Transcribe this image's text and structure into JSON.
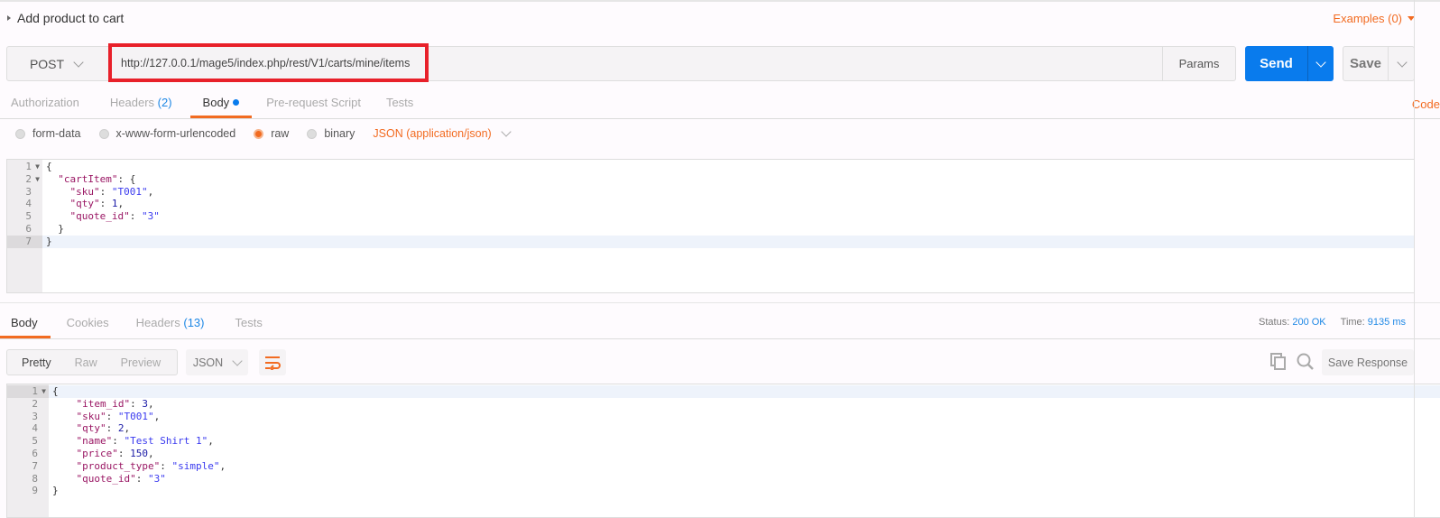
{
  "request": {
    "title": "Add product to cart",
    "examples_label": "Examples (0)",
    "method": "POST",
    "url": "http://127.0.0.1/mage5/index.php/rest/V1/carts/mine/items",
    "params_label": "Params",
    "send_label": "Send",
    "save_label": "Save",
    "code_label": "Code",
    "tabs": [
      {
        "label": "Authorization",
        "count": ""
      },
      {
        "label": "Headers",
        "count": "(2)"
      },
      {
        "label": "Body",
        "count": ""
      },
      {
        "label": "Pre-request Script",
        "count": ""
      },
      {
        "label": "Tests",
        "count": ""
      }
    ],
    "active_tab": "Body",
    "body_modes": [
      "form-data",
      "x-www-form-urlencoded",
      "raw",
      "binary"
    ],
    "selected_mode": "raw",
    "content_type": "JSON (application/json)",
    "body_lines": [
      [
        [
          "p",
          "{"
        ]
      ],
      [
        [
          "p",
          "  "
        ],
        [
          "k",
          "\"cartItem\""
        ],
        [
          "p",
          ": {"
        ]
      ],
      [
        [
          "p",
          "    "
        ],
        [
          "k",
          "\"sku\""
        ],
        [
          "p",
          ": "
        ],
        [
          "s",
          "\"T001\""
        ],
        [
          "p",
          ","
        ]
      ],
      [
        [
          "p",
          "    "
        ],
        [
          "k",
          "\"qty\""
        ],
        [
          "p",
          ": "
        ],
        [
          "n",
          "1"
        ],
        [
          "p",
          ","
        ]
      ],
      [
        [
          "p",
          "    "
        ],
        [
          "k",
          "\"quote_id\""
        ],
        [
          "p",
          ": "
        ],
        [
          "s",
          "\"3\""
        ]
      ],
      [
        [
          "p",
          "  }"
        ]
      ],
      [
        [
          "p",
          "}"
        ]
      ]
    ]
  },
  "response": {
    "tabs": [
      {
        "label": "Body",
        "count": ""
      },
      {
        "label": "Cookies",
        "count": ""
      },
      {
        "label": "Headers",
        "count": "(13)"
      },
      {
        "label": "Tests",
        "count": ""
      }
    ],
    "status_label": "Status:",
    "status_value": "200 OK",
    "time_label": "Time:",
    "time_value": "9135 ms",
    "view_modes": [
      "Pretty",
      "Raw",
      "Preview"
    ],
    "format": "JSON",
    "save_response_label": "Save Response",
    "body_lines": [
      [
        [
          "p",
          "{"
        ]
      ],
      [
        [
          "p",
          "    "
        ],
        [
          "k",
          "\"item_id\""
        ],
        [
          "p",
          ": "
        ],
        [
          "n",
          "3"
        ],
        [
          "p",
          ","
        ]
      ],
      [
        [
          "p",
          "    "
        ],
        [
          "k",
          "\"sku\""
        ],
        [
          "p",
          ": "
        ],
        [
          "s",
          "\"T001\""
        ],
        [
          "p",
          ","
        ]
      ],
      [
        [
          "p",
          "    "
        ],
        [
          "k",
          "\"qty\""
        ],
        [
          "p",
          ": "
        ],
        [
          "n",
          "2"
        ],
        [
          "p",
          ","
        ]
      ],
      [
        [
          "p",
          "    "
        ],
        [
          "k",
          "\"name\""
        ],
        [
          "p",
          ": "
        ],
        [
          "s",
          "\"Test Shirt 1\""
        ],
        [
          "p",
          ","
        ]
      ],
      [
        [
          "p",
          "    "
        ],
        [
          "k",
          "\"price\""
        ],
        [
          "p",
          ": "
        ],
        [
          "n",
          "150"
        ],
        [
          "p",
          ","
        ]
      ],
      [
        [
          "p",
          "    "
        ],
        [
          "k",
          "\"product_type\""
        ],
        [
          "p",
          ": "
        ],
        [
          "s",
          "\"simple\""
        ],
        [
          "p",
          ","
        ]
      ],
      [
        [
          "p",
          "    "
        ],
        [
          "k",
          "\"quote_id\""
        ],
        [
          "p",
          ": "
        ],
        [
          "s",
          "\"3\""
        ]
      ],
      [
        [
          "p",
          "}"
        ]
      ]
    ]
  },
  "colors": {
    "accent": "#f26b21",
    "send": "#097bed",
    "highlight_box": "#e8202a",
    "link": "#1e88e5"
  }
}
